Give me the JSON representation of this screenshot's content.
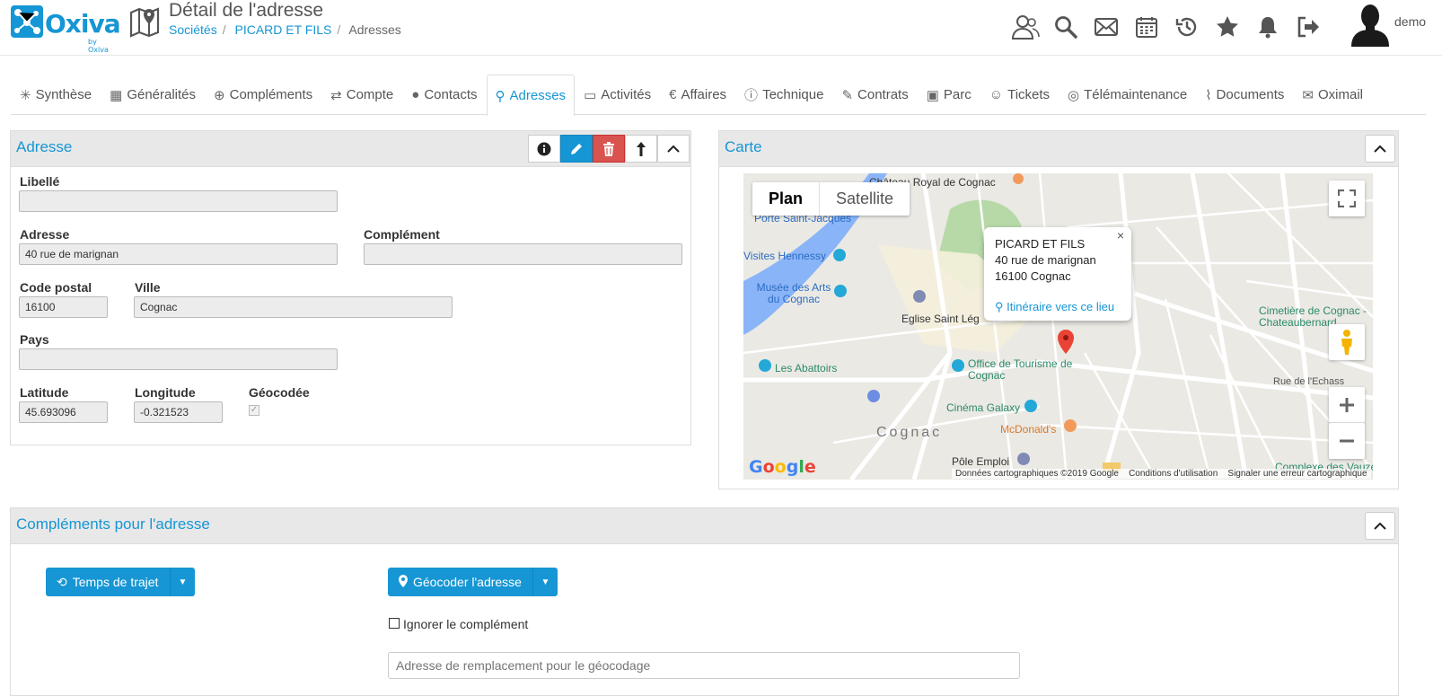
{
  "header": {
    "logo_text": "Oxiva",
    "logo_by": "by Oxiva",
    "title": "Détail de l'adresse",
    "breadcrumb": [
      "Sociétés",
      "PICARD ET FILS",
      "Adresses"
    ],
    "user_name": "demo"
  },
  "tabs": [
    {
      "label": "Synthèse",
      "icon": "synthese-icon"
    },
    {
      "label": "Généralités",
      "icon": "grid-icon"
    },
    {
      "label": "Compléments",
      "icon": "plus-circle-icon"
    },
    {
      "label": "Compte",
      "icon": "refresh-icon"
    },
    {
      "label": "Contacts",
      "icon": "user-icon"
    },
    {
      "label": "Adresses",
      "icon": "map-icon",
      "active": true
    },
    {
      "label": "Activités",
      "icon": "comment-icon"
    },
    {
      "label": "Affaires",
      "icon": "euro-icon"
    },
    {
      "label": "Technique",
      "icon": "alert-icon"
    },
    {
      "label": "Contrats",
      "icon": "contract-icon"
    },
    {
      "label": "Parc",
      "icon": "desktop-icon"
    },
    {
      "label": "Tickets",
      "icon": "support-icon"
    },
    {
      "label": "Télémaintenance",
      "icon": "remote-icon"
    },
    {
      "label": "Documents",
      "icon": "paperclip-icon"
    },
    {
      "label": "Oximail",
      "icon": "mail-icon"
    }
  ],
  "address_panel": {
    "title": "Adresse",
    "fields": {
      "libelle": {
        "label": "Libellé",
        "value": ""
      },
      "adresse": {
        "label": "Adresse",
        "value": "40 rue de marignan"
      },
      "complement": {
        "label": "Complément",
        "value": ""
      },
      "code_postal": {
        "label": "Code postal",
        "value": "16100"
      },
      "ville": {
        "label": "Ville",
        "value": "Cognac"
      },
      "pays": {
        "label": "Pays",
        "value": ""
      },
      "latitude": {
        "label": "Latitude",
        "value": "45.693096"
      },
      "longitude": {
        "label": "Longitude",
        "value": "-0.321523"
      },
      "geocodee": {
        "label": "Géocodée",
        "checked": true
      }
    }
  },
  "map_panel": {
    "title": "Carte",
    "toggle": [
      "Plan",
      "Satellite"
    ],
    "info_window": {
      "line1": "PICARD ET FILS",
      "line2": "40 rue de marignan",
      "line3": "16100 Cognac",
      "link": "Itinéraire vers ce lieu"
    },
    "labels": [
      "Château Royal de Cognac",
      "Porte Saint-Jacques",
      "Visites Hennessy",
      "Musée des Arts du Cognac",
      "Eglise Saint Lég",
      "Les Abattoirs",
      "Office de Tourisme de Cognac",
      "Cinéma Galaxy",
      "McDonald's",
      "Cognac",
      "Pôle Emploi",
      "Cimetière de Cognac - Chateaubernard",
      "Complexe des Vauze",
      "Rue de l'Echass"
    ],
    "google": "Google",
    "footer": [
      "Données cartographiques ©2019 Google",
      "Conditions d'utilisation",
      "Signaler une erreur cartographique"
    ]
  },
  "complements_panel": {
    "title": "Compléments pour l'adresse",
    "travel_button": "Temps de trajet",
    "geocode_button": "Géocoder l'adresse",
    "ignore_label": "Ignorer le complément",
    "replace_placeholder": "Adresse de remplacement pour le géocodage"
  },
  "colors": {
    "accent": "#1696d4",
    "danger": "#d9534f",
    "panel_head": "#e8e8e8"
  }
}
